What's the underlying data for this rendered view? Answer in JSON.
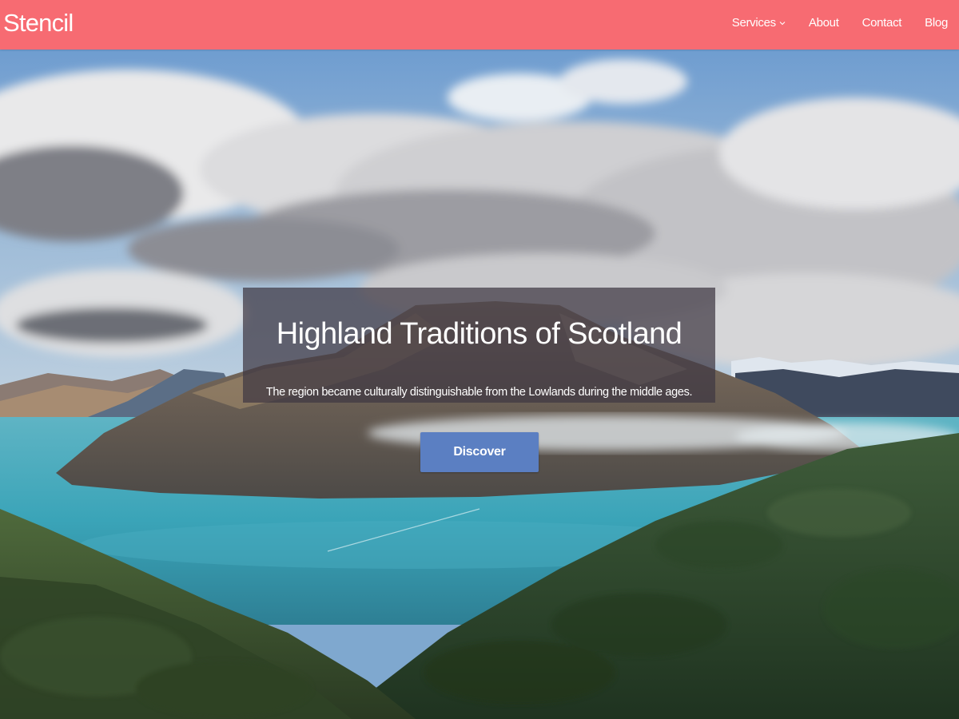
{
  "nav": {
    "brand": "Stencil",
    "links": [
      {
        "label": "Services",
        "has_dropdown": true
      },
      {
        "label": "About"
      },
      {
        "label": "Contact"
      },
      {
        "label": "Blog"
      }
    ]
  },
  "hero": {
    "title": "Highland Traditions of Scotland",
    "subtitle": "The region became culturally distinguishable from the Lowlands during the middle ages.",
    "cta_label": "Discover"
  },
  "colors": {
    "navbar": "#f76b72",
    "cta": "#5b7fc2",
    "panel": "#3e3842",
    "text": "#ffffff"
  },
  "icons": {
    "dropdown": "chevron-down-icon"
  }
}
